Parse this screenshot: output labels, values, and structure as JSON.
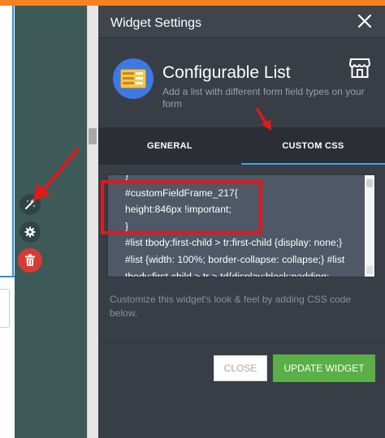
{
  "panel": {
    "title": "Widget Settings",
    "close_glyph": "✕",
    "widget": {
      "name": "Configurable List",
      "description": "Add a list with different form field types on your form",
      "icon": "list-widget-icon",
      "store_icon": "store-icon"
    },
    "tabs": [
      {
        "label": "GENERAL",
        "active": false
      },
      {
        "label": "CUSTOM CSS",
        "active": true
      }
    ],
    "css_editor": {
      "lines": [
        "}",
        "#customFieldFrame_217{",
        "  height:846px !important;",
        "}",
        "#list tbody:first-child > tr:first-child {display: none;}",
        "#list {width: 100%; border-collapse: collapse;} #list",
        "tbody:first-child > tr > td{display:block;padding:"
      ]
    },
    "help_text": "Customize this widget's look & feel by adding CSS code below.",
    "buttons": {
      "close": "CLOSE",
      "update": "UPDATE WIDGET"
    }
  },
  "toolbar": {
    "wand_icon": "magic-wand-icon",
    "gear_icon": "gear-icon",
    "trash_icon": "trash-icon"
  },
  "colors": {
    "accent": "#f58220",
    "panel_bg": "#393e46",
    "tab_underline": "#42a4ea",
    "update_button": "#5aaf46",
    "delete_button": "#d63c35",
    "annotation": "#e0191c"
  }
}
